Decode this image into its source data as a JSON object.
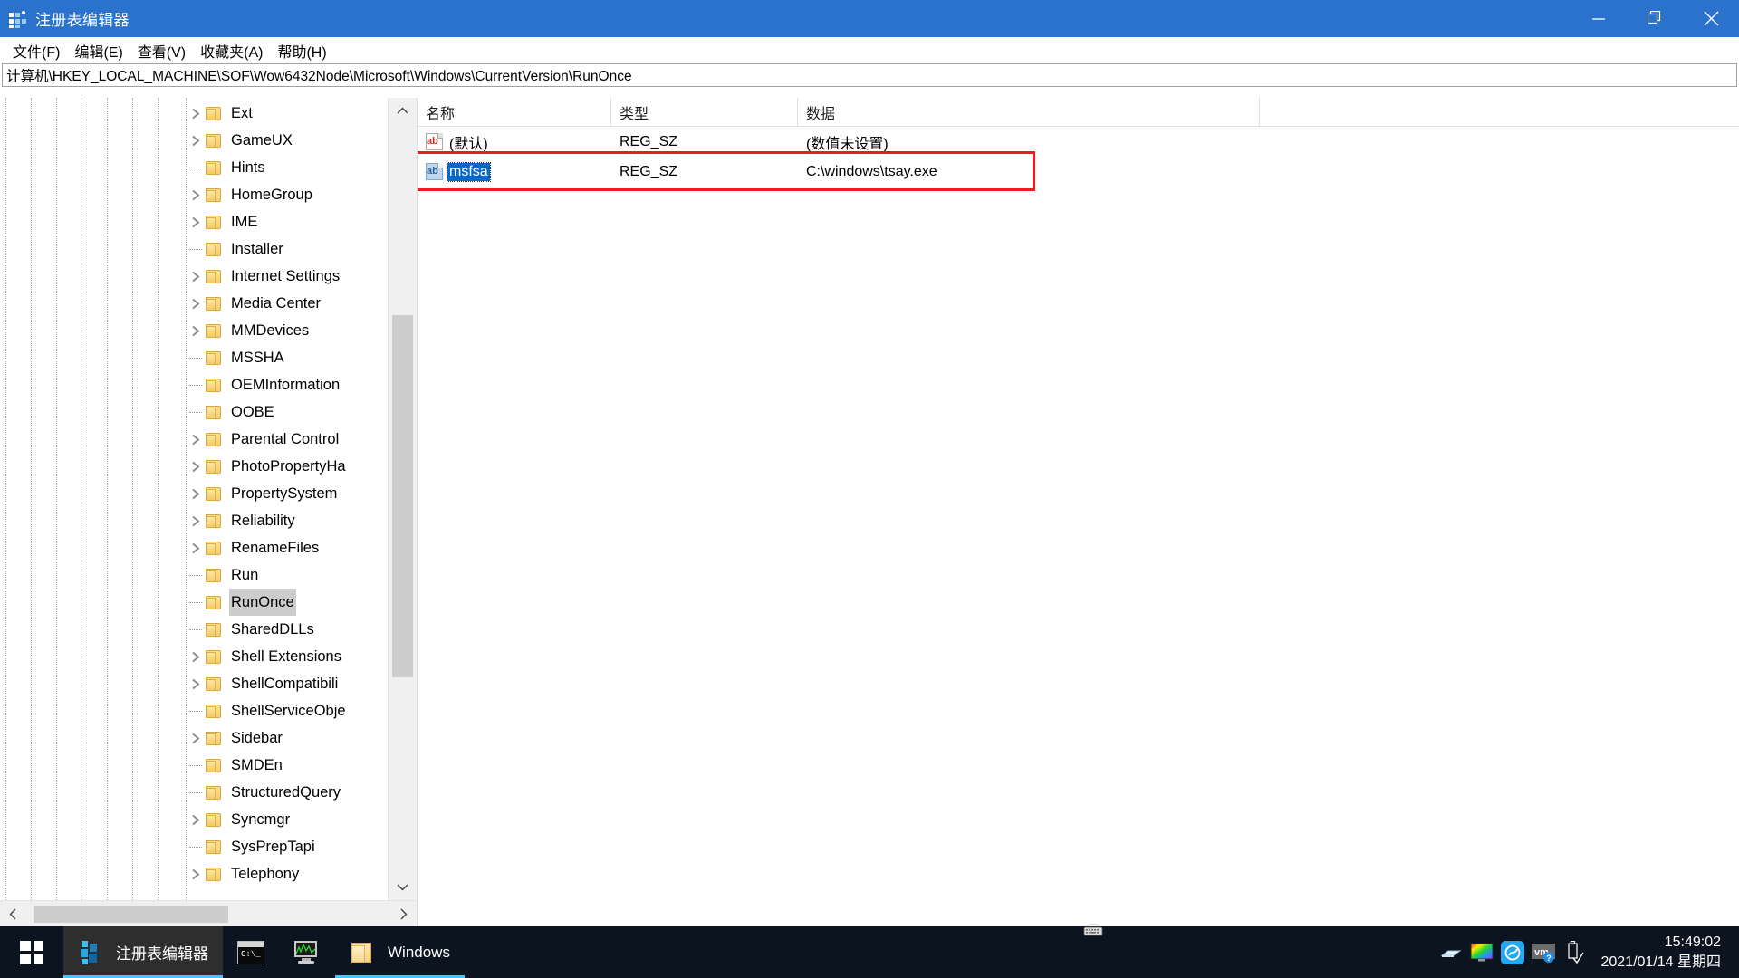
{
  "window": {
    "title": "注册表编辑器",
    "icon": "registry-editor-icon",
    "controls": {
      "minimize": "—",
      "maximize": "❐",
      "close": "✕"
    }
  },
  "menu": {
    "items": [
      {
        "label": "文件(F)",
        "name": "menu-file"
      },
      {
        "label": "编辑(E)",
        "name": "menu-edit"
      },
      {
        "label": "查看(V)",
        "name": "menu-view"
      },
      {
        "label": "收藏夹(A)",
        "name": "menu-favorites"
      },
      {
        "label": "帮助(H)",
        "name": "menu-help"
      }
    ]
  },
  "address": {
    "path": "计算机\\HKEY_LOCAL_MACHINE\\SOF\\Wow6432Node\\Microsoft\\Windows\\CurrentVersion\\RunOnce"
  },
  "tree": {
    "items": [
      {
        "label": "Ext",
        "expandable": true,
        "selected": false
      },
      {
        "label": "GameUX",
        "expandable": true,
        "selected": false
      },
      {
        "label": "Hints",
        "expandable": false,
        "selected": false
      },
      {
        "label": "HomeGroup",
        "expandable": true,
        "selected": false
      },
      {
        "label": "IME",
        "expandable": true,
        "selected": false
      },
      {
        "label": "Installer",
        "expandable": false,
        "selected": false
      },
      {
        "label": "Internet Settings",
        "expandable": true,
        "selected": false
      },
      {
        "label": "Media Center",
        "expandable": true,
        "selected": false
      },
      {
        "label": "MMDevices",
        "expandable": true,
        "selected": false
      },
      {
        "label": "MSSHA",
        "expandable": false,
        "selected": false
      },
      {
        "label": "OEMInformation",
        "expandable": false,
        "selected": false
      },
      {
        "label": "OOBE",
        "expandable": false,
        "selected": false
      },
      {
        "label": "Parental Control",
        "expandable": true,
        "selected": false
      },
      {
        "label": "PhotoPropertyHa",
        "expandable": true,
        "selected": false
      },
      {
        "label": "PropertySystem",
        "expandable": true,
        "selected": false
      },
      {
        "label": "Reliability",
        "expandable": true,
        "selected": false
      },
      {
        "label": "RenameFiles",
        "expandable": true,
        "selected": false
      },
      {
        "label": "Run",
        "expandable": false,
        "selected": false
      },
      {
        "label": "RunOnce",
        "expandable": false,
        "selected": true
      },
      {
        "label": "SharedDLLs",
        "expandable": false,
        "selected": false
      },
      {
        "label": "Shell Extensions",
        "expandable": true,
        "selected": false
      },
      {
        "label": "ShellCompatibili",
        "expandable": true,
        "selected": false
      },
      {
        "label": "ShellServiceObje",
        "expandable": false,
        "selected": false
      },
      {
        "label": "Sidebar",
        "expandable": true,
        "selected": false
      },
      {
        "label": "SMDEn",
        "expandable": false,
        "selected": false
      },
      {
        "label": "StructuredQuery",
        "expandable": false,
        "selected": false
      },
      {
        "label": "Syncmgr",
        "expandable": true,
        "selected": false
      },
      {
        "label": "SysPrepTapi",
        "expandable": false,
        "selected": false
      },
      {
        "label": "Telephony",
        "expandable": true,
        "selected": false
      }
    ]
  },
  "list": {
    "columns": [
      {
        "label": "名称",
        "name": "column-name"
      },
      {
        "label": "类型",
        "name": "column-type"
      },
      {
        "label": "数据",
        "name": "column-data"
      }
    ],
    "rows": [
      {
        "name": "(默认)",
        "type": "REG_SZ",
        "data": "(数值未设置)",
        "icon": "string-value-icon",
        "selected": false
      },
      {
        "name": "msfsa",
        "type": "REG_SZ",
        "data": "C:\\windows\\tsay.exe",
        "icon": "string-value-icon",
        "selected": true
      }
    ]
  },
  "annotation": {
    "color": "#ec1c24",
    "target_row": "msfsa"
  },
  "taskbar": {
    "start": "start-button",
    "buttons": [
      {
        "label": "注册表编辑器",
        "icon": "registry-editor-icon",
        "active": true,
        "name": "taskbar-registry-editor"
      },
      {
        "label": "",
        "icon": "command-prompt-icon",
        "active": false,
        "name": "taskbar-command-prompt"
      },
      {
        "label": "",
        "icon": "task-manager-icon",
        "active": false,
        "name": "taskbar-task-manager"
      },
      {
        "label": "Windows",
        "icon": "folder-icon",
        "active": false,
        "name": "taskbar-windows-folder"
      }
    ],
    "tray": [
      {
        "name": "keyboard-indicator-icon"
      },
      {
        "name": "network-icon"
      },
      {
        "name": "display-color-icon"
      },
      {
        "name": "wechat-icon"
      },
      {
        "name": "vmware-icon"
      },
      {
        "name": "safely-remove-hardware-icon"
      }
    ],
    "clock": {
      "time": "15:49:02",
      "date": "2021/01/14 星期四"
    }
  },
  "colors": {
    "titlebar": "#2A72CB",
    "selection": "#0a69c8",
    "tree_selection": "#cdcdcd",
    "annotation": "#ec1c24",
    "taskbar": "#0c1420"
  }
}
